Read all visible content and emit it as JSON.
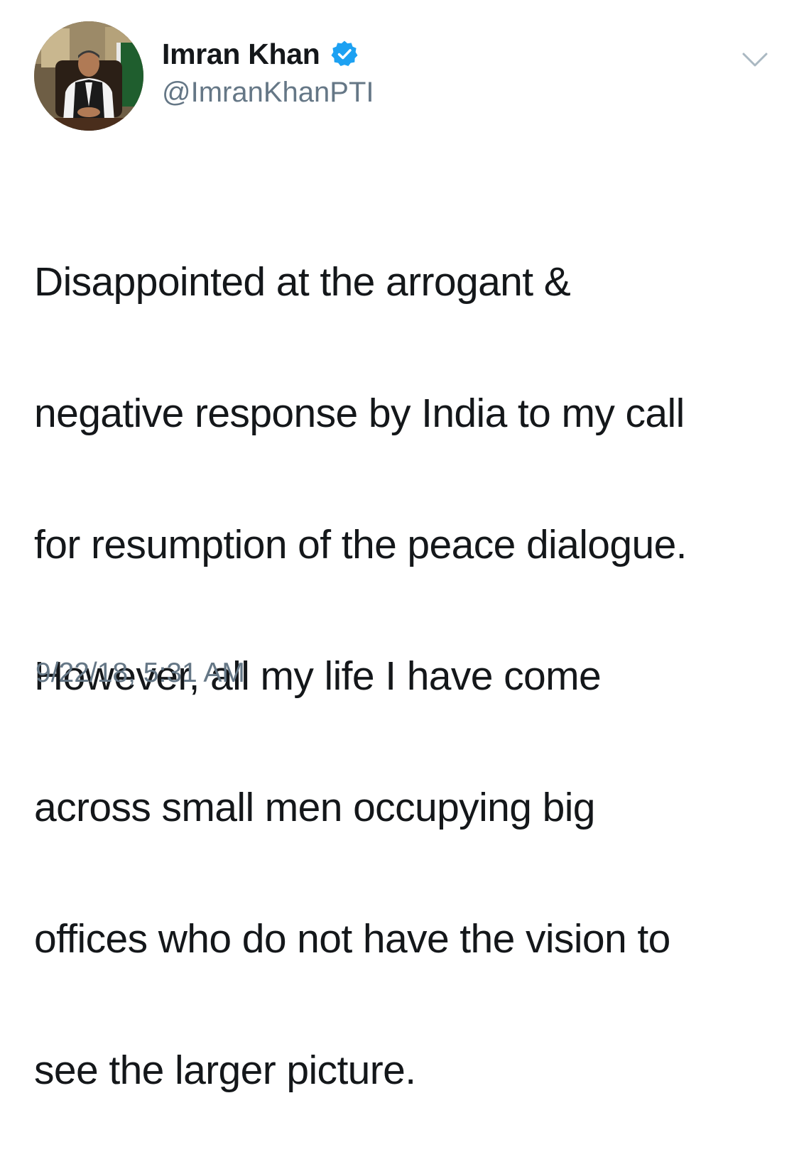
{
  "author": {
    "display_name": "Imran Khan",
    "handle": "@ImranKhanPTI",
    "verified": true
  },
  "icons": {
    "avatar": "profile-photo",
    "verified": "verified-badge-icon",
    "menu": "chevron-down-icon"
  },
  "colors": {
    "verified_blue": "#1da1f2",
    "secondary_text": "#657786",
    "primary_text": "#14171a",
    "chevron": "#aab8c2"
  },
  "tweet": {
    "lines": [
      "Disappointed at the arrogant &",
      "negative response by India to my call",
      "for resumption of the peace dialogue.",
      "However, all my life I have come",
      "across small men occupying big",
      "offices who do not have the vision to",
      "see the larger picture."
    ],
    "timestamp": "9/22/18, 5:31 AM"
  }
}
